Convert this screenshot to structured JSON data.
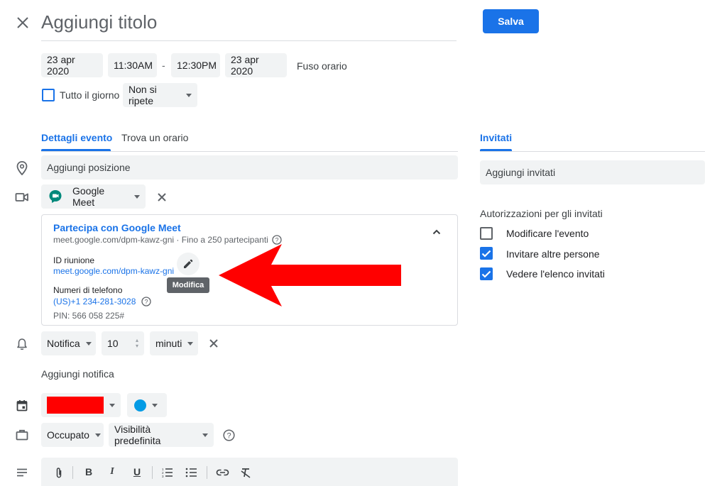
{
  "header": {
    "close_icon": "close-icon",
    "title_placeholder": "Aggiungi titolo",
    "save_label": "Salva"
  },
  "datetime": {
    "start_date": "23 apr 2020",
    "start_time": "11:30AM",
    "separator": "-",
    "end_time": "12:30PM",
    "end_date": "23 apr 2020",
    "timezone": "Fuso orario",
    "all_day_label": "Tutto il giorno",
    "all_day_checked": false,
    "repeat": "Non si ripete"
  },
  "tabs": [
    {
      "label": "Dettagli evento",
      "active": true
    },
    {
      "label": "Trova un orario",
      "active": false
    }
  ],
  "details": {
    "location_placeholder": "Aggiungi posizione",
    "conference_label": "Google Meet",
    "meet": {
      "join_link": "Partecipa con Google Meet",
      "subtitle": "meet.google.com/dpm-kawz-gni · Fino a 250 partecipanti",
      "meeting_id_label": "ID riunione",
      "meeting_id_value": "meet.google.com/dpm-kawz-gni",
      "edit_tooltip": "Modifica",
      "phone_label": "Numeri di telefono",
      "phone_value": "(US)+1 234-281-3028",
      "pin": "PIN: 566 058 225#"
    },
    "notification": {
      "type": "Notifica",
      "amount": "10",
      "unit": "minuti"
    },
    "add_notification": "Aggiungi notifica",
    "calendar_color": "#ff0000",
    "event_color": "#039be5",
    "availability": "Occupato",
    "visibility": "Visibilità predefinita"
  },
  "guests": {
    "tab_label": "Invitati",
    "add_placeholder": "Aggiungi invitati",
    "permissions_title": "Autorizzazioni per gli invitati",
    "permissions": [
      {
        "label": "Modificare l'evento",
        "checked": false
      },
      {
        "label": "Invitare altre persone",
        "checked": true
      },
      {
        "label": "Vedere l'elenco invitati",
        "checked": true
      }
    ]
  },
  "colors": {
    "accent": "#1a73e8",
    "annotation_arrow": "#ff0000",
    "meet_green": "#00897b"
  }
}
